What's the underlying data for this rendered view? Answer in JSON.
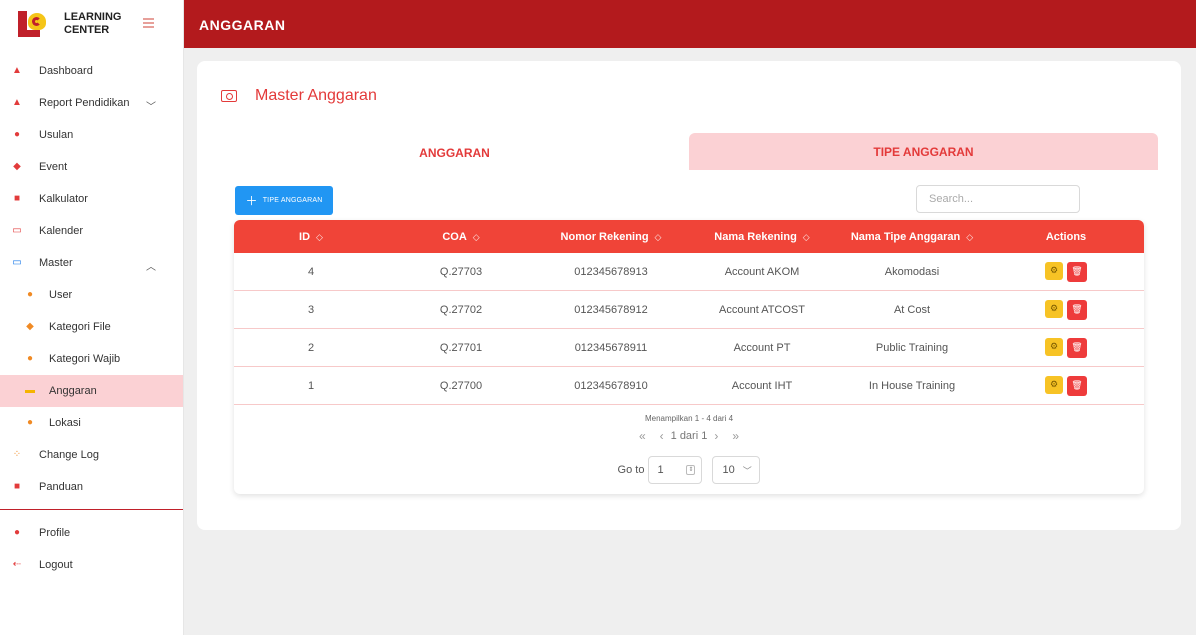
{
  "sidebar": {
    "brand": "LEARNING\nCENTER",
    "items": [
      {
        "label": "Dashboard",
        "icon": "home-icon"
      },
      {
        "label": "Report Pendidikan",
        "icon": "flask-icon"
      },
      {
        "label": "Usulan",
        "icon": "pin-icon"
      },
      {
        "label": "Event",
        "icon": "graduation-cap-icon"
      },
      {
        "label": "Kalkulator",
        "icon": "calculator-icon"
      },
      {
        "label": "Kalender",
        "icon": "calendar-icon"
      },
      {
        "label": "Master",
        "icon": "monitor-icon"
      },
      {
        "label": "User",
        "icon": "users-icon"
      },
      {
        "label": "Kategori File",
        "icon": "tag-icon"
      },
      {
        "label": "Kategori Wajib",
        "icon": "circle-icon"
      },
      {
        "label": "Anggaran",
        "icon": "money-icon"
      },
      {
        "label": "Lokasi",
        "icon": "location-icon"
      },
      {
        "label": "Change Log",
        "icon": "dots-icon"
      },
      {
        "label": "Panduan",
        "icon": "book-icon"
      },
      {
        "label": "Profile",
        "icon": "user-circle-icon"
      },
      {
        "label": "Logout",
        "icon": "logout-icon"
      }
    ]
  },
  "header": {
    "title": "ANGGARAN"
  },
  "main": {
    "title": "Master Anggaran",
    "tabs": [
      {
        "label": "ANGGARAN",
        "active": true
      },
      {
        "label": "TIPE ANGGARAN",
        "active": false
      }
    ],
    "add_button": "TIPE ANGGARAN",
    "search_placeholder": "Search...",
    "columns": [
      "ID",
      "COA",
      "Nomor Rekening",
      "Nama Rekening",
      "Nama Tipe Anggaran",
      "Actions"
    ],
    "rows": [
      {
        "id": "4",
        "coa": "Q.27703",
        "nomor": "012345678913",
        "nama": "Account AKOM",
        "tipe": "Akomodasi"
      },
      {
        "id": "3",
        "coa": "Q.27702",
        "nomor": "012345678912",
        "nama": "Account ATCOST",
        "tipe": "At Cost"
      },
      {
        "id": "2",
        "coa": "Q.27701",
        "nomor": "012345678911",
        "nama": "Account PT",
        "tipe": "Public Training"
      },
      {
        "id": "1",
        "coa": "Q.27700",
        "nomor": "012345678910",
        "nama": "Account IHT",
        "tipe": "In House Training"
      }
    ],
    "pagination": {
      "info": "Menampilkan 1 - 4 dari 4",
      "page_text": "1 dari 1",
      "goto_label": "Go to",
      "goto_value": "1",
      "page_size": "10"
    }
  },
  "colors": {
    "primary": "#b31a1d",
    "accent": "#e33a3a",
    "header_row": "#f04438",
    "tab_inactive": "#fbd1d4",
    "button": "#2196f3"
  }
}
